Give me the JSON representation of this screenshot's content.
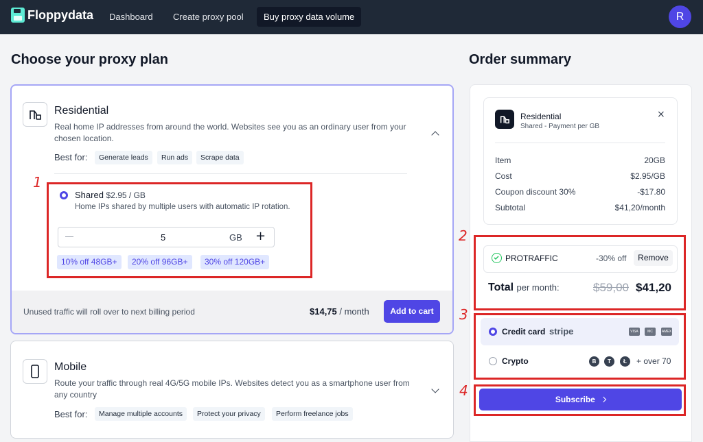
{
  "nav": {
    "brand": "Floppydata",
    "links": [
      "Dashboard",
      "Create proxy pool",
      "Buy proxy data volume"
    ],
    "avatar": "R"
  },
  "main": {
    "heading": "Choose your proxy plan",
    "plans": [
      {
        "title": "Residential",
        "desc": "Real home IP addresses from around the world. Websites see you as an ordinary user from your chosen location.",
        "best_for_label": "Best for:",
        "tags": [
          "Generate leads",
          "Run ads",
          "Scrape data"
        ],
        "option": {
          "name": "Shared",
          "price": "$2.95 / GB",
          "desc": "Home IPs shared by multiple users with automatic IP rotation."
        },
        "stepper": {
          "value": "5",
          "unit": "GB"
        },
        "discounts": [
          "10% off 48GB+",
          "20% off 96GB+",
          "30% off 120GB+"
        ],
        "footer_note": "Unused traffic will roll over to next billing period",
        "price_amount": "$14,75",
        "price_period": " / month",
        "cta": "Add to cart"
      },
      {
        "title": "Mobile",
        "desc": "Route your traffic through real 4G/5G mobile IPs. Websites detect you as a smartphone user from any country",
        "best_for_label": "Best for:",
        "tags": [
          "Manage multiple accounts",
          "Protect your privacy",
          "Perform freelance jobs"
        ]
      }
    ]
  },
  "summary": {
    "heading": "Order summary",
    "item_title": "Residential",
    "item_sub": "Shared - Payment per GB",
    "rows": [
      {
        "label": "Item",
        "value": "20GB"
      },
      {
        "label": "Cost",
        "value": "$2.95/GB"
      },
      {
        "label": "Coupon discount 30%",
        "value": "-$17.80"
      },
      {
        "label": "Subtotal",
        "value": "$41,20/month"
      }
    ],
    "coupon": {
      "code": "PROTRAFFIC",
      "discount": "-30% off",
      "remove": "Remove"
    },
    "total": {
      "label": "Total",
      "per": "per month:",
      "old": "$59,00",
      "new": "$41,20"
    },
    "payment": [
      {
        "label": "Credit card",
        "provider": "stripe",
        "cards": [
          "VISA",
          "MC",
          "AMEX"
        ]
      },
      {
        "label": "Crypto",
        "coins": [
          "B",
          "T",
          "Ł"
        ],
        "more": "+ over 70"
      }
    ],
    "subscribe": "Subscribe"
  },
  "annotations": [
    "1",
    "2",
    "3",
    "4"
  ],
  "colors": {
    "accent": "#4f46e5",
    "nav": "#1f2937",
    "annotation": "#dc2626",
    "success": "#22c55e"
  }
}
